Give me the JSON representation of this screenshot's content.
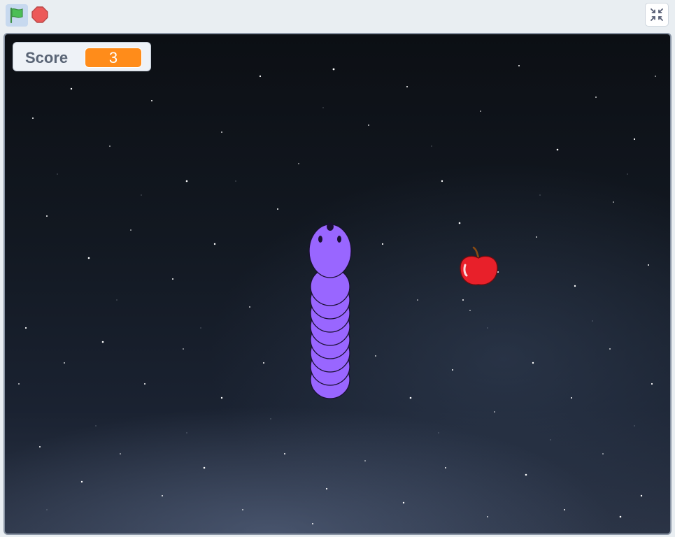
{
  "toolbar": {
    "green_flag_icon": "green-flag-icon",
    "stop_icon": "stop-sign-icon",
    "fullscreen_icon": "exit-fullscreen-icon"
  },
  "monitor": {
    "label": "Score",
    "value": "3"
  },
  "sprites": {
    "snake": {
      "name": "snake",
      "color": "#9966ff",
      "segments": 9
    },
    "apple": {
      "name": "apple",
      "color": "#e8202a"
    }
  },
  "colors": {
    "accent": "#ff8c1a",
    "stage_border": "#8893a3",
    "flag_green": "#4cbf56",
    "stop_red": "#ec5959"
  }
}
